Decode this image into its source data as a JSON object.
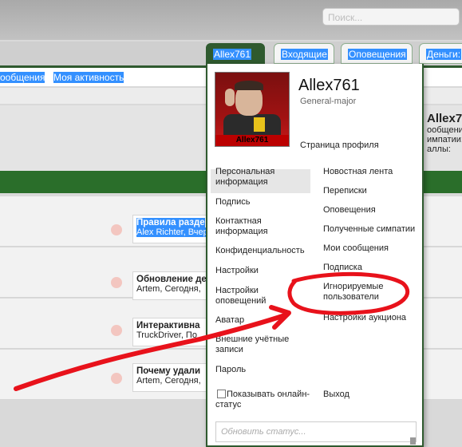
{
  "header": {
    "search_placeholder": "Поиск..."
  },
  "tabs": {
    "account": "Allex761",
    "inbox": "Входящие",
    "alerts": "Оповещения",
    "money": "Деньги:"
  },
  "subnav": {
    "messages": "ообщения",
    "my_activity": "Моя активность"
  },
  "forums": [
    {
      "title": "Правила разде",
      "meta": "Alex Richter, Вчер"
    },
    {
      "title": "Обновление де",
      "meta": "Artem, Сегодня,"
    },
    {
      "title": "Интерактивна",
      "meta": "TruckDriver, По"
    },
    {
      "title": "Почему удали",
      "meta": "Artem, Сегодня,"
    }
  ],
  "bg_profile": {
    "name": "Allex76",
    "line1": "ообщения",
    "line2": "импатии:",
    "line3": "аллы:"
  },
  "popup": {
    "username": "Allex761",
    "rank": "General-major",
    "avatar_caption": "Allex761",
    "profile_link": "Страница профиля",
    "left_links": [
      "Персональная информация",
      "Подпись",
      "Контактная информация",
      "Конфиденциальность",
      "Настройки",
      "Настройки оповещений",
      "Аватар",
      "Внешние учётные записи",
      "Пароль"
    ],
    "right_links": [
      "Новостная лента",
      "Переписки",
      "Оповещения",
      "Полученные симпатии",
      "Мои сообщения",
      "Подписка",
      "Игнорируемые пользователи",
      "Настройки аукциона"
    ],
    "show_online": "Показывать онлайн-статус",
    "logout": "Выход",
    "status_placeholder": "Обновить статус..."
  },
  "annotation_color": "#e8121b"
}
